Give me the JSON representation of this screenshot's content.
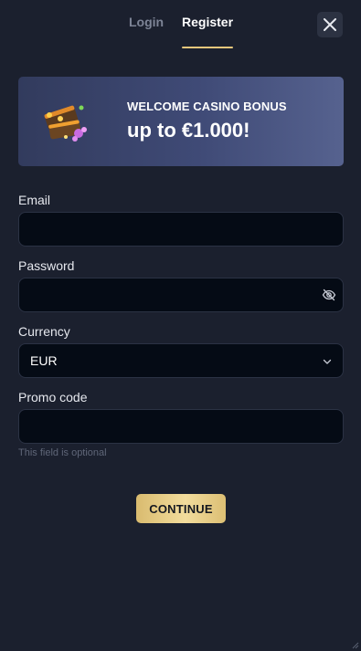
{
  "tabs": {
    "login": "Login",
    "register": "Register",
    "active": "register"
  },
  "close_icon": "close-icon",
  "banner": {
    "kicker": "WELCOME CASINO BONUS",
    "amount": "up to €1.000!",
    "art_icon": "treasure-chest-icon"
  },
  "form": {
    "email": {
      "label": "Email",
      "value": "",
      "placeholder": ""
    },
    "password": {
      "label": "Password",
      "value": "",
      "placeholder": "",
      "toggle_icon": "eye-off-icon"
    },
    "currency": {
      "label": "Currency",
      "value": "EUR",
      "icon": "chevron-down-icon"
    },
    "promo": {
      "label": "Promo code",
      "value": "",
      "placeholder": "",
      "helper": "This field is optional"
    }
  },
  "continue_label": "CONTINUE",
  "colors": {
    "background": "#1b202e",
    "accent_gold": "#e9c77c",
    "input_bg": "#050b15",
    "banner_start": "#323b5d",
    "banner_end": "#56628f"
  }
}
